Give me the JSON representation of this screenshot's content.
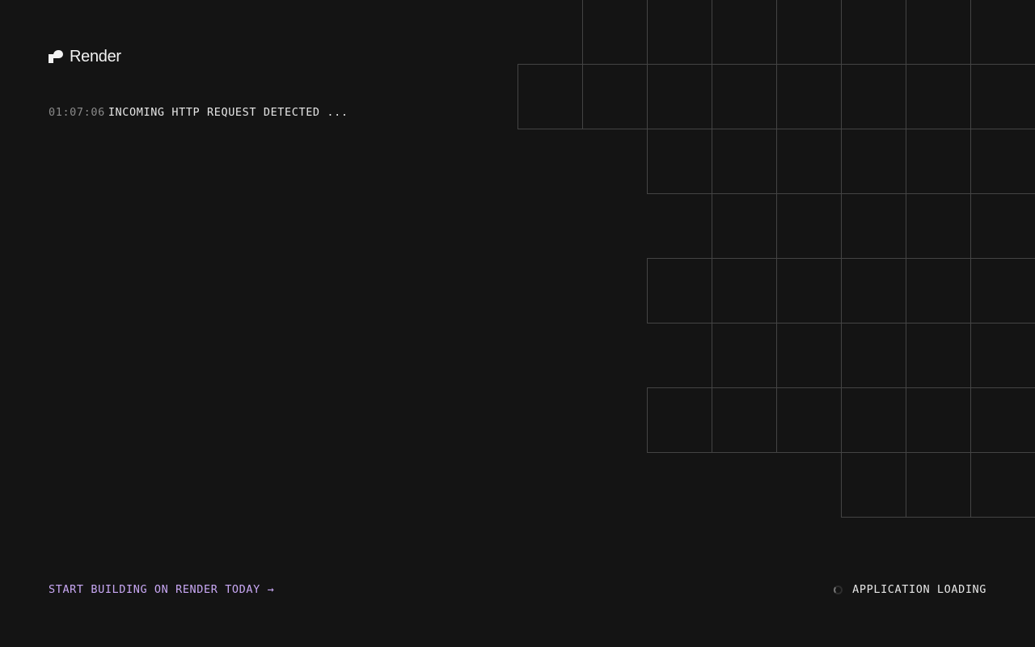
{
  "brand": {
    "name": "Render",
    "icon": "render-logo-icon"
  },
  "log": {
    "timestamp": "01:07:06",
    "message": "INCOMING HTTP REQUEST DETECTED ..."
  },
  "cta": {
    "label": "START BUILDING ON RENDER TODAY",
    "arrow": "→"
  },
  "status": {
    "label": "APPLICATION LOADING",
    "icon": "spinner-icon"
  },
  "colors": {
    "background": "#141414",
    "accent": "#c9a8f5",
    "grid": "#444444"
  }
}
